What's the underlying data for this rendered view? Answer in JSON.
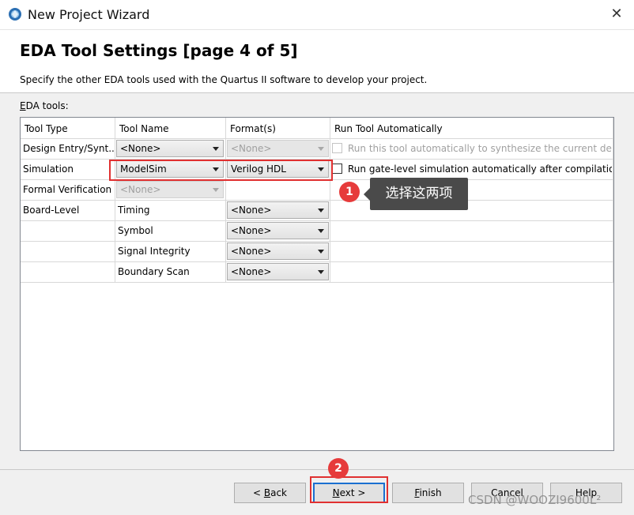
{
  "window": {
    "title": "New Project Wizard",
    "close_glyph": "✕"
  },
  "header": {
    "heading": "EDA Tool Settings [page 4 of 5]",
    "description": "Specify the other EDA tools used with the Quartus II software to develop your project."
  },
  "section_label_prefix": "E",
  "section_label_rest": "DA tools:",
  "table": {
    "columns": [
      "Tool Type",
      "Tool Name",
      "Format(s)",
      "Run Tool Automatically"
    ],
    "rows": [
      {
        "type": "Design Entry/Synt...",
        "tool": "<None>",
        "tool_combo": true,
        "tool_disabled": false,
        "format": "<None>",
        "format_disabled": true,
        "run_label": "Run this tool automatically to synthesize the current design",
        "run_disabled": true
      },
      {
        "type": "Simulation",
        "tool": "ModelSim",
        "tool_combo": true,
        "tool_disabled": false,
        "format": "Verilog HDL",
        "format_disabled": false,
        "run_label": "Run gate-level simulation automatically after compilation",
        "run_disabled": false
      },
      {
        "type": "Formal Verification",
        "tool": "<None>",
        "tool_combo": true,
        "tool_disabled": true,
        "format": "",
        "run_label": ""
      },
      {
        "type": "Board-Level",
        "tool": "Timing",
        "format": "<None>",
        "format_disabled": false
      },
      {
        "type": "",
        "tool": "Symbol",
        "format": "<None>",
        "format_disabled": false
      },
      {
        "type": "",
        "tool": "Signal Integrity",
        "format": "<None>",
        "format_disabled": false
      },
      {
        "type": "",
        "tool": "Boundary Scan",
        "format": "<None>",
        "format_disabled": false
      }
    ]
  },
  "annotations": {
    "badge1": "1",
    "badge2": "2",
    "tooltip": "选择这两项"
  },
  "buttons": {
    "back": {
      "pre": "< ",
      "mnemonic": "B",
      "rest": "ack"
    },
    "next": {
      "mnemonic": "N",
      "rest": "ext >"
    },
    "finish": {
      "mnemonic": "F",
      "rest": "inish"
    },
    "cancel": {
      "label": "Cancel"
    },
    "help": {
      "label": "Help"
    }
  },
  "watermark": "CSDN @WOOZI9600L²",
  "colors": {
    "annotation_red": "#e03030",
    "default_button_border": "#1a6fd0",
    "tooltip_bg": "#4a4a4a"
  }
}
